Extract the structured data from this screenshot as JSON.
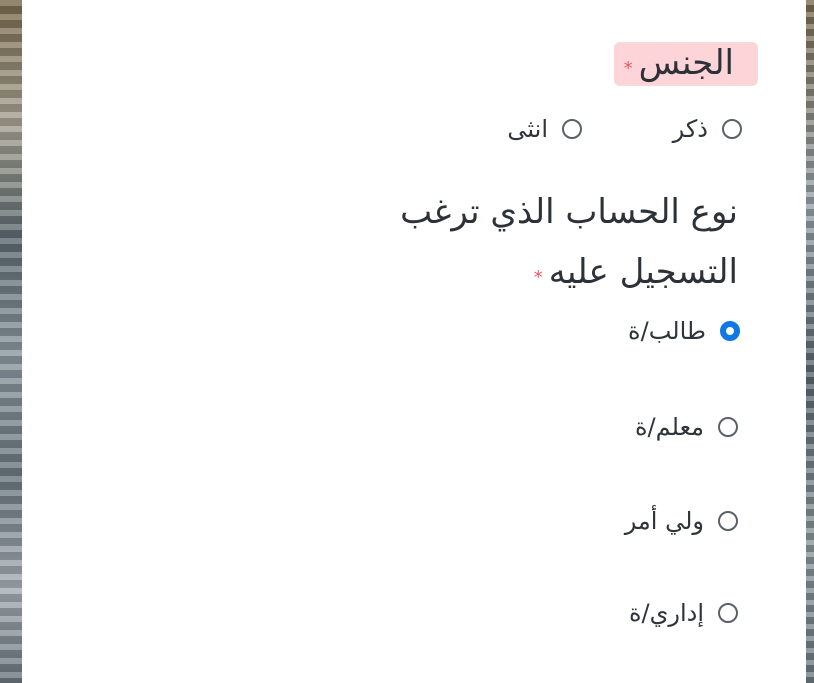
{
  "form": {
    "gender": {
      "label": "الجنس",
      "required_mark": "*",
      "options": [
        {
          "label": "ذكر",
          "selected": false
        },
        {
          "label": "انثى",
          "selected": false
        }
      ]
    },
    "account_type": {
      "label": "نوع الحساب الذي ترغب التسجيل عليه",
      "required_mark": "*",
      "options": [
        {
          "label": "طالب/ة",
          "selected": true
        },
        {
          "label": "معلم/ة",
          "selected": false
        },
        {
          "label": "ولي أمر",
          "selected": false
        },
        {
          "label": "إداري/ة",
          "selected": false
        }
      ]
    }
  },
  "colors": {
    "accent": "#0f78e6",
    "required": "#e25a66",
    "highlight": "#fdd5d9"
  }
}
